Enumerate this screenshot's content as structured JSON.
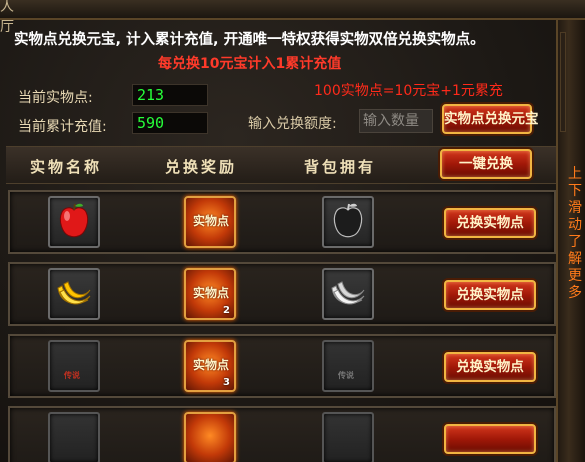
{
  "window": {
    "title_fragment": "人厅"
  },
  "notice": {
    "main": "实物点兑换元宝, 计入累计充值, 开通唯一特权获得实物双倍兑换实物点。",
    "sub": "每兑换10元宝计入1累计充值",
    "rate": "100实物点=10元宝+1元累充"
  },
  "stats": {
    "points_label": "当前实物点:",
    "points_value": "213",
    "recharge_label": "当前累计充值:",
    "recharge_value": "590"
  },
  "exchange": {
    "input_label": "输入兑换额度:",
    "input_placeholder": "输入数量",
    "convert_button": "实物点兑换元宝"
  },
  "table": {
    "headers": [
      "实物名称",
      "兑换奖励",
      "背包拥有"
    ],
    "one_click_button": "一键兑换",
    "rows": [
      {
        "item_icon": "red-apple-icon",
        "reward_label": "实物点",
        "reward_count": "",
        "owned_icon": "grey-apple-icon",
        "button": "兑换实物点"
      },
      {
        "item_icon": "golden-banana-icon",
        "reward_label": "实物点",
        "reward_count": "2",
        "owned_icon": "grey-banana-icon",
        "button": "兑换实物点"
      },
      {
        "item_icon": "legendary-item-icon",
        "item_label": "传说",
        "reward_label": "实物点",
        "reward_count": "3",
        "owned_icon": "grey-legendary-item-icon",
        "owned_label": "传说",
        "button": "兑换实物点"
      }
    ]
  },
  "scroll_hint": [
    "上",
    "下",
    "滑",
    "动",
    "了",
    "解",
    "更",
    "多"
  ],
  "colors": {
    "accent_red": "#ff3a2a",
    "value_green": "#27ff3a",
    "scroll_hint_orange": "#ff7a1a",
    "button_red": "#a11808",
    "button_border_gold": "#f1b542"
  }
}
